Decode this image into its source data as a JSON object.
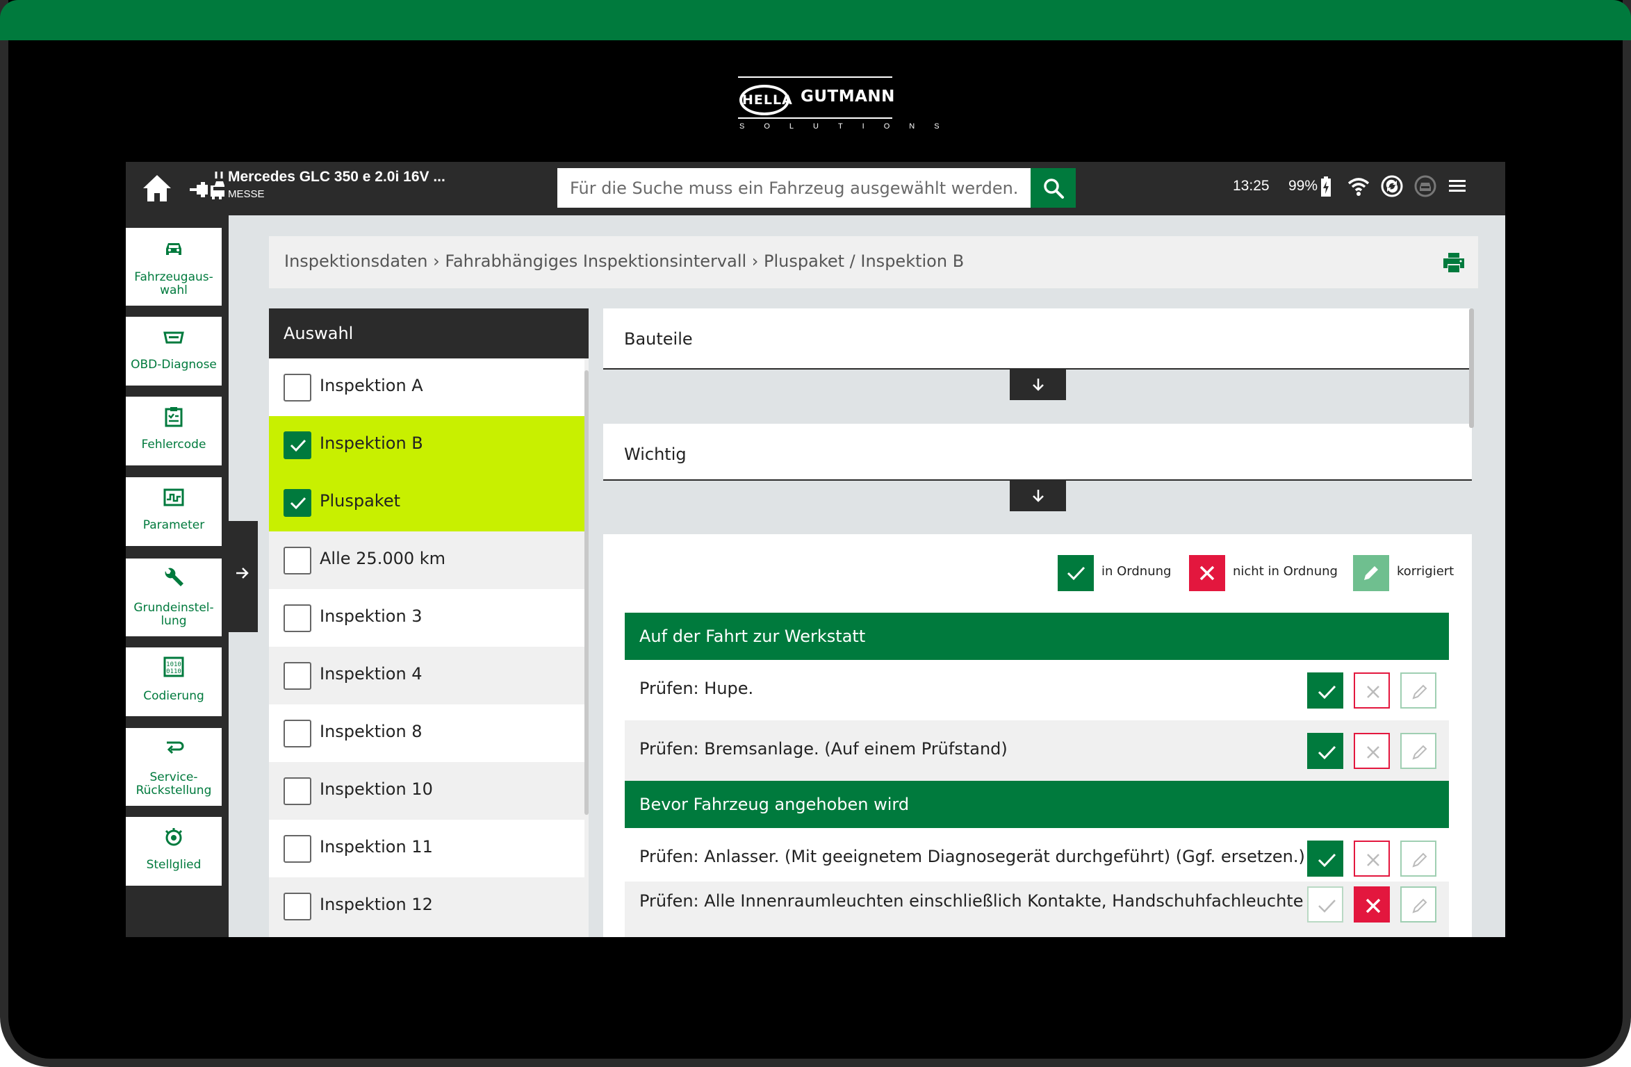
{
  "brand": {
    "left_logo": "HELLA",
    "right_logo": "GUTMANN",
    "tagline": "SOLUTIONS"
  },
  "colors": {
    "primary_green": "#007a3d",
    "highlight_lime": "#c8f000",
    "error_red": "#e3173e",
    "dark": "#2b2b2b",
    "panel_gray": "#f0f0f0",
    "background_gray": "#dfe3e5"
  },
  "header": {
    "home_icon": "home-icon",
    "vehicle_icon": "car-plug-icon",
    "vehicle_name": "Mercedes GLC 350 e 2.0i 16V ...",
    "vehicle_sub": "MESSE",
    "search_placeholder": "Für die Suche muss ein Fahrzeug ausgewählt werden.",
    "search_icon": "search-icon",
    "time": "13:25",
    "battery": "99%",
    "battery_level": 0.99,
    "status_icons": [
      "battery-icon",
      "wifi-icon",
      "sync-icon",
      "car-status-icon",
      "menu-icon"
    ]
  },
  "sidebar": {
    "items": [
      {
        "label": "Fahrzeugaus-\nwahl",
        "icon": "car-icon"
      },
      {
        "label": "OBD-Diagnose",
        "icon": "obd-plug-icon"
      },
      {
        "label": "Fehlercode",
        "icon": "clipboard-icon"
      },
      {
        "label": "Parameter",
        "icon": "signal-icon"
      },
      {
        "label": "Grundeinstel-\nlung",
        "icon": "wrench-icon"
      },
      {
        "label": "Codierung",
        "icon": "binary-icon"
      },
      {
        "label": "Service-\nRückstellung",
        "icon": "reset-arrow-icon"
      },
      {
        "label": "Stellglied",
        "icon": "actuator-icon"
      }
    ],
    "expand_icon": "arrow-right-icon"
  },
  "breadcrumb": {
    "text": "Inspektionsdaten › Fahrabhängiges Inspektionsintervall › Pluspaket / Inspektion B",
    "print_icon": "print-icon"
  },
  "selection": {
    "title": "Auswahl",
    "items": [
      {
        "label": "Inspektion A",
        "checked": false
      },
      {
        "label": "Inspektion B",
        "checked": true
      },
      {
        "label": "Pluspaket",
        "checked": true
      },
      {
        "label": "Alle 25.000 km",
        "checked": false
      },
      {
        "label": "Inspektion 3",
        "checked": false
      },
      {
        "label": "Inspektion 4",
        "checked": false
      },
      {
        "label": "Inspektion 8",
        "checked": false
      },
      {
        "label": "Inspektion 10",
        "checked": false
      },
      {
        "label": "Inspektion 11",
        "checked": false
      },
      {
        "label": "Inspektion 12",
        "checked": false
      }
    ]
  },
  "sections": [
    {
      "title": "Bauteile",
      "expand_icon": "arrow-down-icon"
    },
    {
      "title": "Wichtig",
      "expand_icon": "arrow-down-icon"
    }
  ],
  "legend": {
    "ok": "in Ordnung",
    "not_ok": "nicht in Ordnung",
    "corrected": "korrigiert"
  },
  "checklist": {
    "groups": [
      {
        "title": "Auf der Fahrt zur Werkstatt",
        "items": [
          {
            "text": "Prüfen: Hupe.",
            "status": "ok"
          },
          {
            "text": "Prüfen: Bremsanlage. (Auf einem Prüfstand)",
            "status": "ok"
          }
        ]
      },
      {
        "title": "Bevor Fahrzeug angehoben wird",
        "items": [
          {
            "text": "Prüfen: Anlasser. (Mit geeignetem Diagnosegerät durchgeführt) (Ggf. ersetzen.)",
            "status": "ok"
          },
          {
            "text": "Prüfen: Alle Innenraumleuchten einschließlich Kontakte, Handschuhfachleuchte und",
            "status": "not_ok"
          }
        ]
      }
    ]
  }
}
